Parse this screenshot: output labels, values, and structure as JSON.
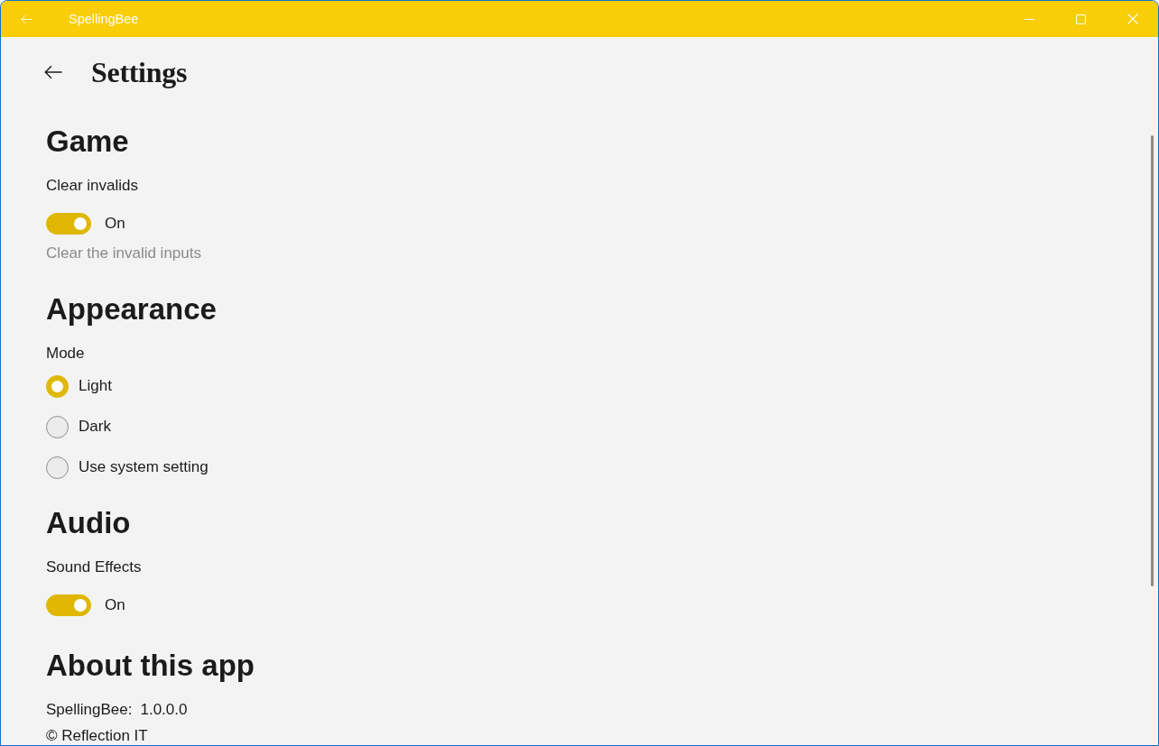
{
  "window": {
    "title": "SpellingBee"
  },
  "page": {
    "title": "Settings"
  },
  "sections": [
    {
      "heading": "Game",
      "settings": [
        {
          "kind": "toggle",
          "label": "Clear invalids",
          "on": true,
          "state_text": "On",
          "description": "Clear the invalid inputs"
        }
      ]
    },
    {
      "heading": "Appearance",
      "settings": [
        {
          "kind": "radio_group",
          "label": "Mode",
          "options": [
            {
              "label": "Light",
              "selected": true
            },
            {
              "label": "Dark",
              "selected": false
            },
            {
              "label": "Use system setting",
              "selected": false
            }
          ]
        }
      ]
    },
    {
      "heading": "Audio",
      "settings": [
        {
          "kind": "toggle",
          "label": "Sound Effects",
          "on": true,
          "state_text": "On"
        }
      ]
    },
    {
      "heading": "About this app",
      "settings": [
        {
          "kind": "version",
          "label": "SpellingBee:",
          "value": "1.0.0.0"
        },
        {
          "kind": "text",
          "text": "© Reflection IT"
        }
      ]
    }
  ]
}
